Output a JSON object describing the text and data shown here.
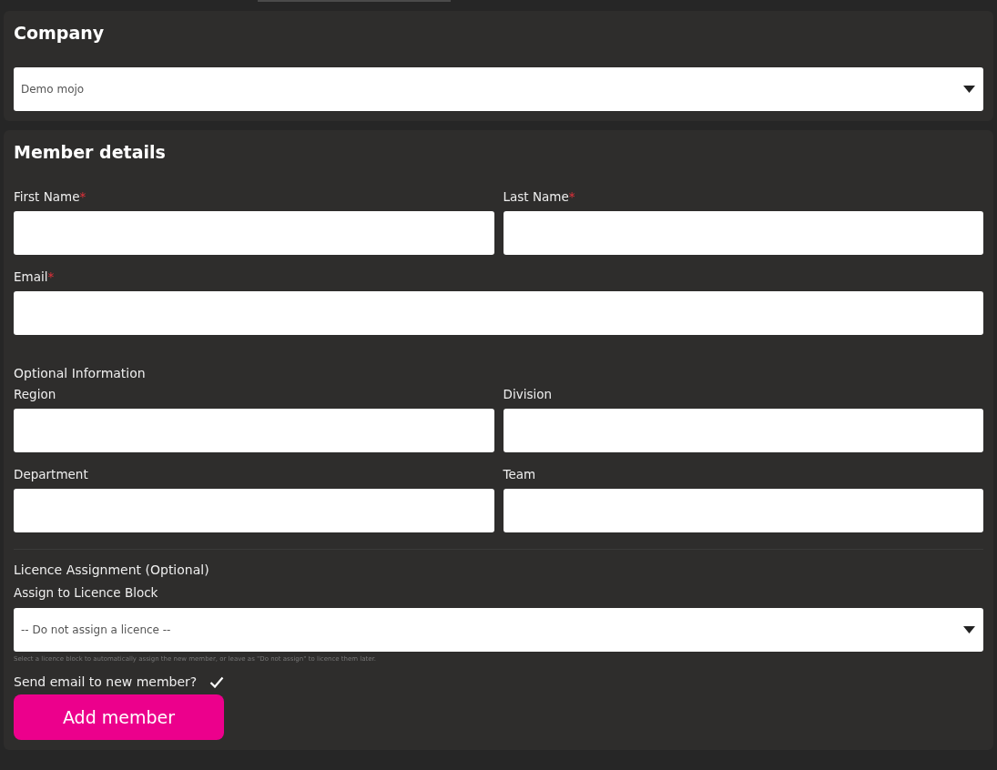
{
  "company": {
    "title": "Company",
    "select": {
      "value": "Demo mojo"
    }
  },
  "member_details": {
    "title": "Member details",
    "required_fields": [
      {
        "label": "First Name",
        "required_mark": "*",
        "wide": false
      },
      {
        "label": "Last Name",
        "required_mark": "*",
        "wide": false
      },
      {
        "label": "Email",
        "required_mark": "*",
        "wide": true
      }
    ],
    "optional_heading": "Optional Information",
    "optional_fields": [
      {
        "label": "Region"
      },
      {
        "label": "Division"
      },
      {
        "label": "Department"
      },
      {
        "label": "Team"
      }
    ],
    "licence_heading": "Licence Assignment (Optional)",
    "licence_label": "Assign to Licence Block",
    "licence_select": {
      "value": "-- Do not assign a licence --"
    },
    "licence_help": "Select a licence block to automatically assign the new member, or leave as \"Do not assign\" to licence them later.",
    "send_email": {
      "label": "Send email to new member?",
      "checked": true
    },
    "submit_button": "Add member"
  }
}
